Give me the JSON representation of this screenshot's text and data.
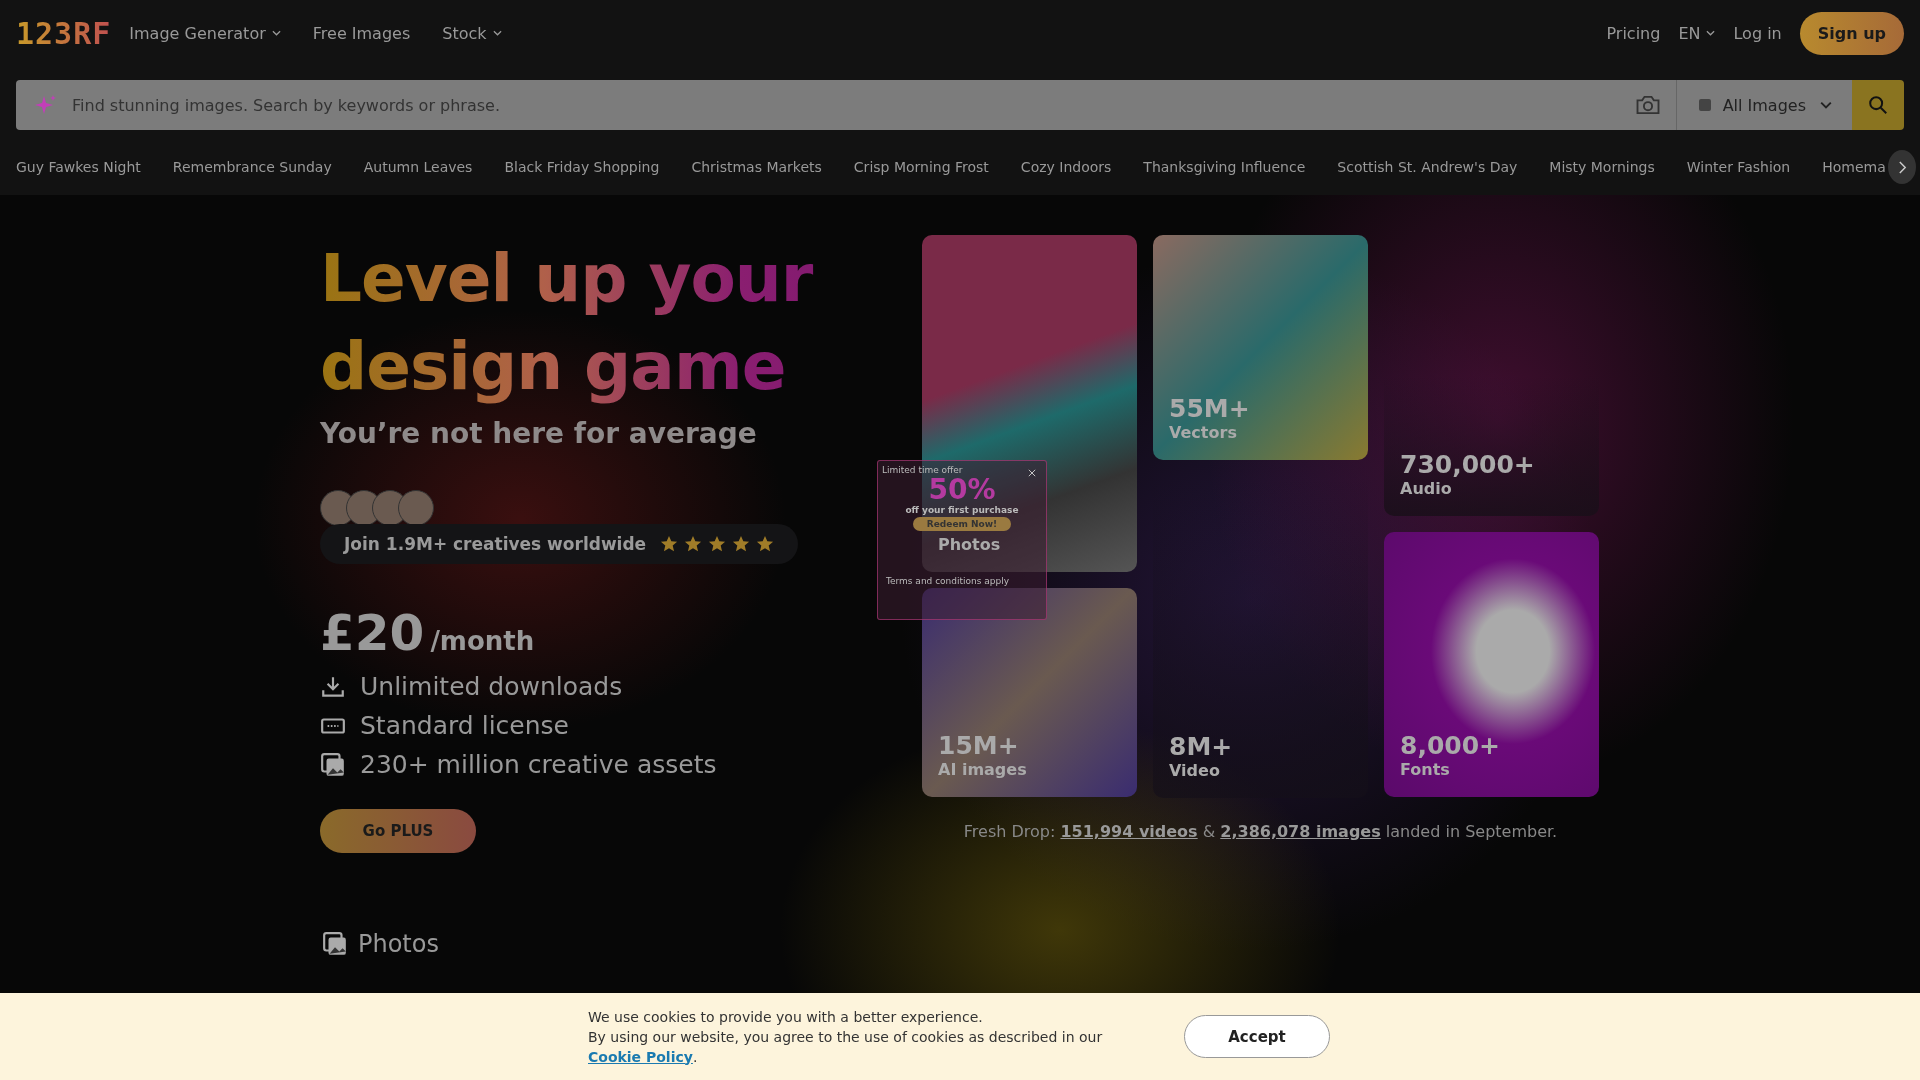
{
  "header": {
    "logo": "123RF",
    "nav": [
      {
        "label": "Image Generator",
        "dropdown": true
      },
      {
        "label": "Free Images",
        "dropdown": false
      },
      {
        "label": "Stock",
        "dropdown": true
      }
    ],
    "pricing": "Pricing",
    "language": "EN",
    "login": "Log in",
    "signup": "Sign up"
  },
  "search": {
    "placeholder": "Find stunning images. Search by keywords or phrase.",
    "filter": "All Images"
  },
  "trending": [
    "Guy Fawkes Night",
    "Remembrance Sunday",
    "Autumn Leaves",
    "Black Friday Shopping",
    "Christmas Markets",
    "Crisp Morning Frost",
    "Cozy Indoors",
    "Thanksgiving Influence",
    "Scottish St. Andrew's Day",
    "Misty Mornings",
    "Winter Fashion",
    "Homema"
  ],
  "hero": {
    "title": "Level up your design game",
    "subtitle": "You’re not here for average",
    "social": {
      "text": "Join 1.9M+ creatives worldwide",
      "stars": 5
    },
    "price": "£20",
    "period": "/month",
    "features": [
      {
        "kind": "download",
        "text": "Unlimited downloads"
      },
      {
        "kind": "license",
        "text": "Standard license"
      },
      {
        "kind": "assets",
        "text": "230+ million creative assets"
      }
    ],
    "cta": "Go PLUS"
  },
  "tiles": [
    {
      "kind": "photos",
      "label": "Photos"
    },
    {
      "kind": "ai",
      "count": "15M+",
      "label": "AI images"
    },
    {
      "kind": "vectors",
      "count": "55M+",
      "label": "Vectors"
    },
    {
      "kind": "video",
      "count": "8M+",
      "label": "Video"
    },
    {
      "kind": "audio",
      "count": "730,000+",
      "label": "Audio"
    },
    {
      "kind": "fonts",
      "count": "8,000+",
      "label": "Fonts"
    }
  ],
  "popup": {
    "tag": "Limited time offer",
    "headline": "50%",
    "subline": "off your first purchase",
    "button": "Redeem Now!",
    "terms_title": "Terms and conditions apply"
  },
  "fresh_drop": {
    "prefix": "Fresh Drop:",
    "videos": "151,994 videos",
    "amp": "&",
    "images": "2,386,078 images",
    "suffix": "landed in September."
  },
  "section": {
    "title": "Photos"
  },
  "cookie": {
    "line1": "We use cookies to provide you with a better experience.",
    "line2": "By using our website, you agree to the use of cookies as described in our",
    "link": "Cookie Policy",
    "end": ".",
    "accept": "Accept"
  }
}
